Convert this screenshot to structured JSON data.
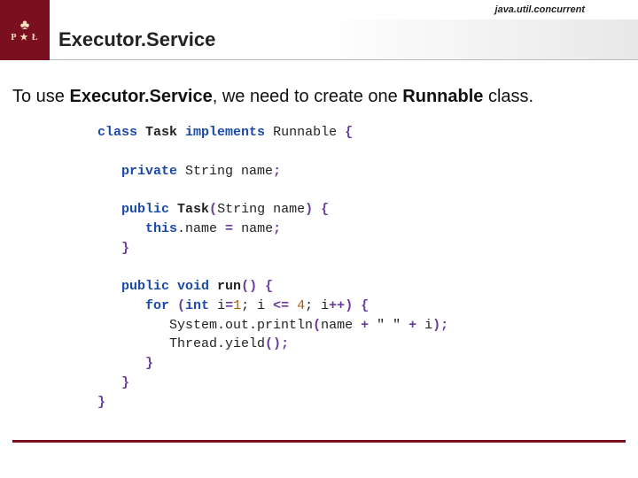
{
  "header": {
    "package": "java.util.concurrent",
    "title": "Executor.Service",
    "logo_top": "♣",
    "logo_bottom": "P ★ Ł"
  },
  "intro": {
    "pre": "To use ",
    "bold1": "Executor.Service",
    "mid": ", we need to create one ",
    "bold2": "Runnable",
    "post": " class."
  },
  "code": {
    "l1a": "class ",
    "l1b": "Task ",
    "l1c": "implements ",
    "l1d": "Runnable ",
    "l1e": "{",
    "l2a": "private ",
    "l2b": "String name",
    "l2c": ";",
    "l3a": "public ",
    "l3b": "Task",
    "l3c": "(",
    "l3d": "String name",
    "l3e": ")",
    "l3f": " {",
    "l4a": "this",
    "l4b": ".name ",
    "l4c": "= ",
    "l4d": "name",
    "l4e": ";",
    "l5a": "}",
    "l6a": "public ",
    "l6b": "void ",
    "l6c": "run",
    "l6d": "()",
    "l6e": " {",
    "l7a": "for ",
    "l7b": "(",
    "l7c": "int ",
    "l7d": "i",
    "l7e": "=",
    "l7f": "1",
    "l7g": "; i ",
    "l7h": "<= ",
    "l7i": "4",
    "l7j": "; i",
    "l7k": "++",
    "l7l": ")",
    "l7m": " {",
    "l8a": "System",
    "l8b": ".out",
    "l8c": ".println",
    "l8d": "(",
    "l8e": "name ",
    "l8f": "+ ",
    "l8g": "\" \" ",
    "l8h": "+ ",
    "l8i": "i",
    "l8j": ")",
    "l8k": ";",
    "l9a": "Thread",
    "l9b": ".yield",
    "l9c": "()",
    "l9d": ";",
    "l10a": "}",
    "l11a": "}",
    "l12a": "}"
  }
}
